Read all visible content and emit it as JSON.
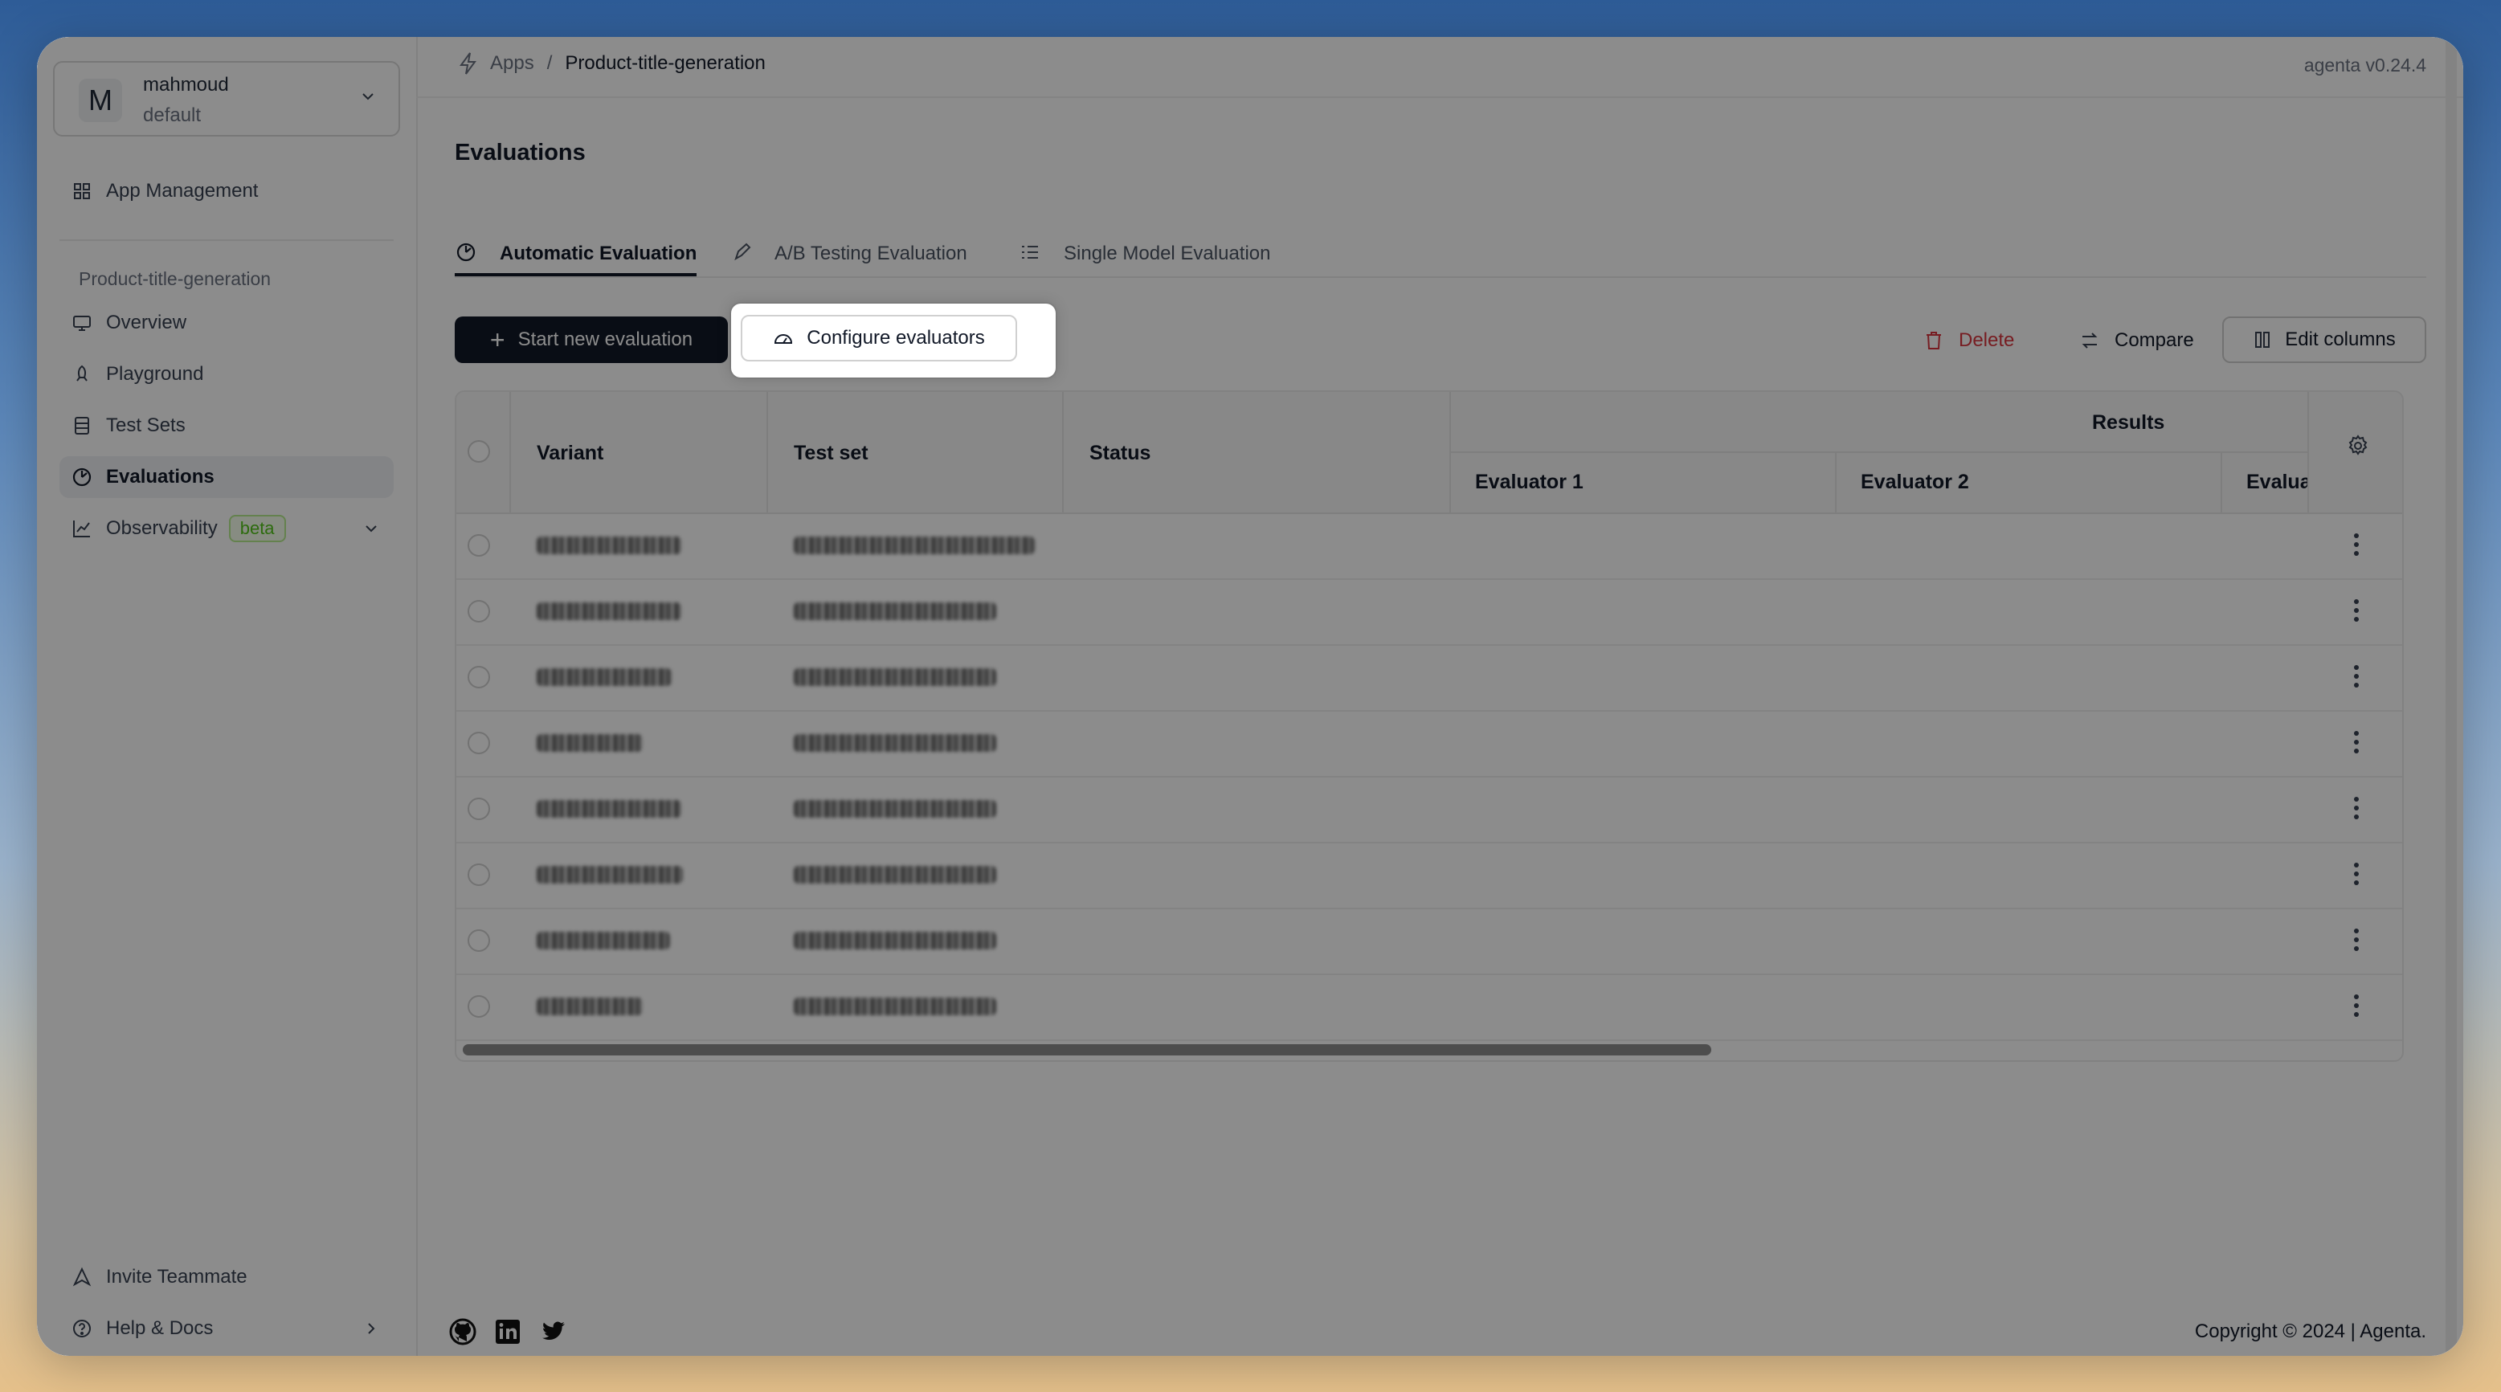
{
  "workspace": {
    "initial": "M",
    "name": "mahmoud",
    "sub": "default"
  },
  "sidebar": {
    "app_management": "App Management",
    "group_label": "Product-title-generation",
    "items": [
      {
        "label": "Overview"
      },
      {
        "label": "Playground"
      },
      {
        "label": "Test Sets"
      },
      {
        "label": "Evaluations"
      },
      {
        "label": "Observability",
        "badge": "beta"
      }
    ],
    "invite": "Invite Teammate",
    "help": "Help & Docs"
  },
  "topbar": {
    "apps": "Apps",
    "separator": "/",
    "current": "Product-title-generation",
    "version": "agenta v0.24.4"
  },
  "page_title": "Evaluations",
  "tabs": [
    {
      "label": "Automatic Evaluation",
      "active": true
    },
    {
      "label": "A/B Testing Evaluation",
      "active": false
    },
    {
      "label": "Single Model Evaluation",
      "active": false
    }
  ],
  "toolbar": {
    "start_label": "Start new evaluation",
    "configure_label": "Configure evaluators",
    "delete_label": "Delete",
    "compare_label": "Compare",
    "edit_columns_label": "Edit columns"
  },
  "table": {
    "columns": {
      "variant": "Variant",
      "test_set": "Test set",
      "status": "Status",
      "results": "Results"
    },
    "evaluators": [
      "Evaluator 1",
      "Evaluator 2",
      "Evaluat"
    ],
    "row_count": 8
  },
  "footer": {
    "copyright": "Copyright © 2024 | Agenta."
  },
  "colors": {
    "primary": "#111827",
    "danger": "#d9363e",
    "beta_green": "#52c41a"
  }
}
